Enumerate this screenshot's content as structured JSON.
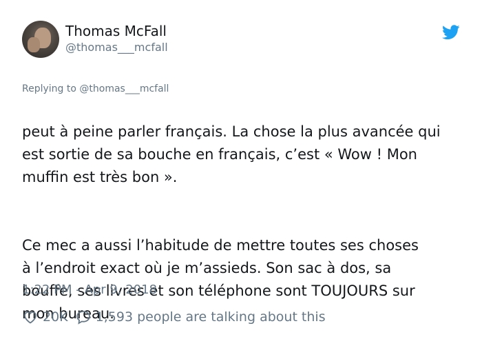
{
  "author": {
    "name": "Thomas McFall",
    "handle": "@thomas___mcfall"
  },
  "reply": {
    "prefix": "Replying to ",
    "to": "@thomas___mcfall"
  },
  "tweet": {
    "paragraphs": [
      "peut à peine parler français. La chose la plus avancée qui\nest sortie de sa bouche en français, c’est « Wow ! Mon\nmuffin est très bon ».",
      "Ce mec a aussi l’habitude de mettre toutes ses choses\nà l’endroit exact où je m’assieds. Son sac à dos, sa\nbouffe, ses livres et son téléphone sont TOUJOURS sur\nmon bureau."
    ],
    "timestamp": "1:22 PM - Apr 9, 2018"
  },
  "actions": {
    "likes": "20K",
    "talking": "1,593 people are talking about this"
  },
  "colors": {
    "text": "#14171a",
    "muted": "#657786",
    "twitter_blue": "#1da1f2"
  },
  "icons": {
    "platform": "twitter-bird-icon",
    "like": "heart-icon",
    "reply": "speech-bubble-icon"
  }
}
